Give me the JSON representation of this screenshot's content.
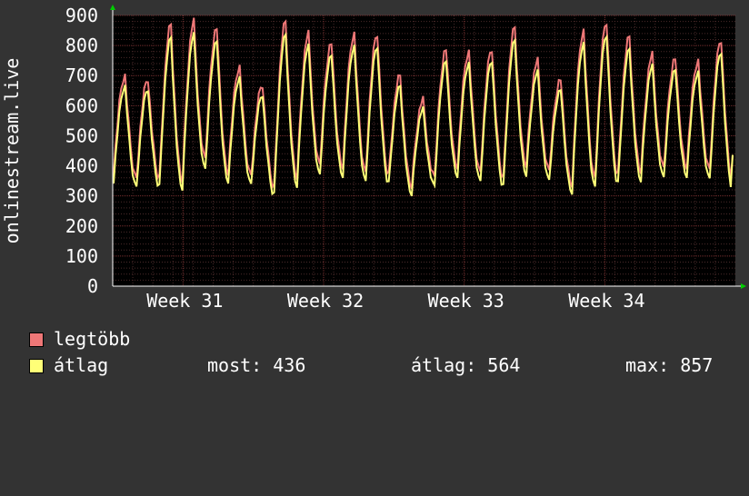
{
  "chart_data": {
    "type": "line",
    "ylabel": "onlinestream.live",
    "ylim": [
      0,
      900
    ],
    "yticks": [
      "0",
      "100",
      "200",
      "300",
      "400",
      "500",
      "600",
      "700",
      "800",
      "900"
    ],
    "xticks": [
      "Week 31",
      "Week 32",
      "Week 33",
      "Week 34"
    ],
    "grid": true,
    "legend_placement": "bottom",
    "days": 31,
    "day_peaks_max": [
      700,
      690,
      870,
      880,
      860,
      730,
      670,
      880,
      840,
      810,
      840,
      840,
      700,
      620,
      790,
      780,
      790,
      860,
      750,
      690,
      850,
      880,
      830,
      770,
      760,
      750,
      820
    ],
    "day_troughs_max": [
      380,
      360,
      360,
      350,
      420,
      380,
      370,
      330,
      360,
      400,
      400,
      380,
      370,
      330,
      360,
      400,
      380,
      360,
      400,
      380,
      340,
      360,
      370,
      380,
      390,
      400,
      390,
      350
    ],
    "series": [
      {
        "name": "legtöbb",
        "color": "#ee7777"
      },
      {
        "name": "átlag",
        "color": "#ffff77"
      }
    ]
  },
  "legend": {
    "max_label": "legtöbb",
    "avg_label": "átlag",
    "stats": {
      "most": "most: 436",
      "atlag": "átlag: 564",
      "max": "max: 857"
    },
    "max_color": "#ee7777",
    "avg_color": "#ffff77"
  }
}
